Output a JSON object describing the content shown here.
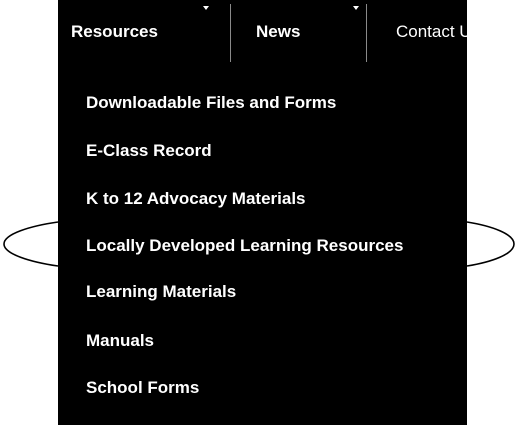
{
  "topnav": {
    "items": [
      {
        "label": "Resources",
        "has_dropdown": true
      },
      {
        "label": "News",
        "has_dropdown": true
      },
      {
        "label": "Contact U",
        "has_dropdown": false
      }
    ]
  },
  "dropdown": {
    "items": [
      {
        "label": "Downloadable Files and Forms"
      },
      {
        "label": "E-Class Record"
      },
      {
        "label": "K to 12 Advocacy Materials"
      },
      {
        "label": "Locally Developed Learning Resources",
        "highlighted": true
      },
      {
        "label": "Learning Materials"
      },
      {
        "label": "Manuals"
      },
      {
        "label": "School Forms"
      }
    ]
  },
  "colors": {
    "menu_background": "#000000",
    "menu_text": "#ffffff",
    "divider": "#8a8a8a",
    "annotation_outline": "#000000"
  }
}
